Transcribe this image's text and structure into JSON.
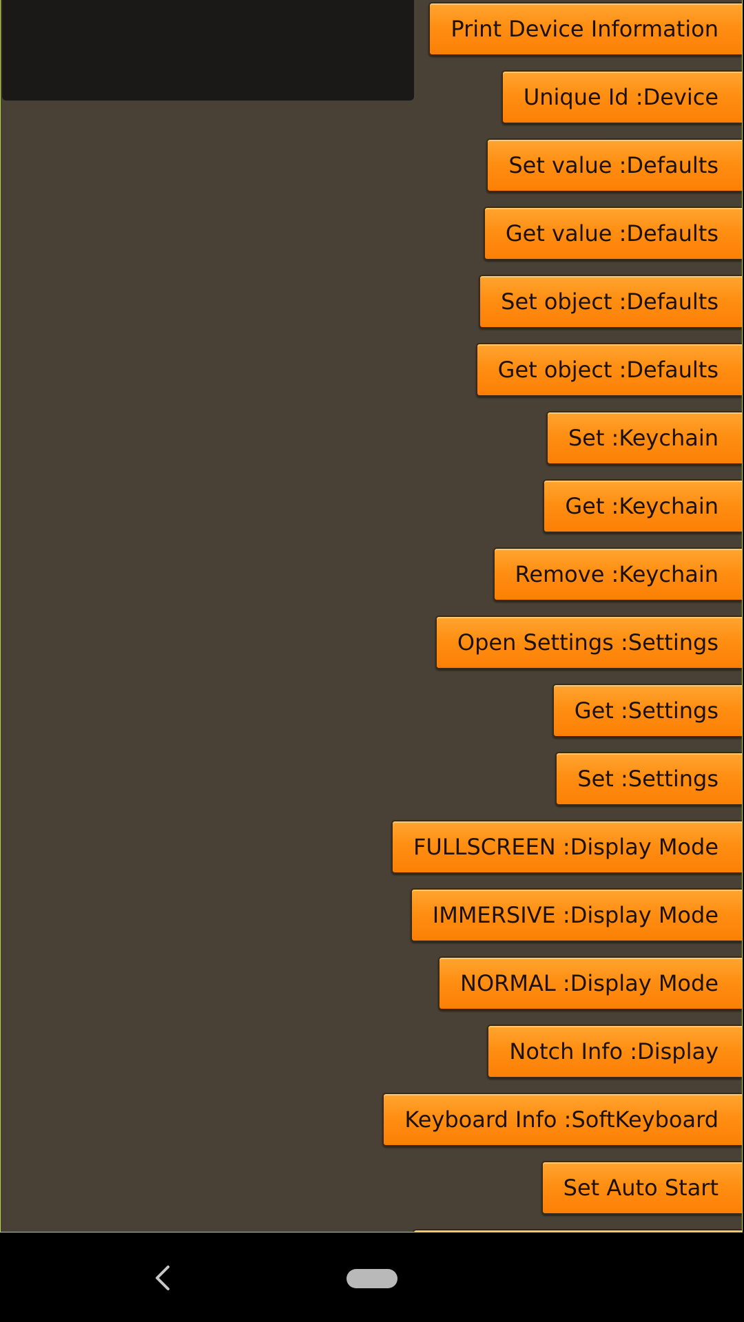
{
  "buttons": [
    {
      "id": "print-device-information",
      "label": "Print Device Information"
    },
    {
      "id": "unique-id-device",
      "label": "Unique Id :Device"
    },
    {
      "id": "set-value-defaults",
      "label": "Set value :Defaults"
    },
    {
      "id": "get-value-defaults",
      "label": "Get value :Defaults"
    },
    {
      "id": "set-object-defaults",
      "label": "Set object :Defaults"
    },
    {
      "id": "get-object-defaults",
      "label": "Get object :Defaults"
    },
    {
      "id": "set-keychain",
      "label": "Set :Keychain"
    },
    {
      "id": "get-keychain",
      "label": "Get :Keychain"
    },
    {
      "id": "remove-keychain",
      "label": "Remove :Keychain"
    },
    {
      "id": "open-settings-settings",
      "label": "Open Settings :Settings"
    },
    {
      "id": "get-settings",
      "label": "Get :Settings"
    },
    {
      "id": "set-settings",
      "label": "Set :Settings"
    },
    {
      "id": "fullscreen-display-mode",
      "label": "FULLSCREEN :Display Mode"
    },
    {
      "id": "immersive-display-mode",
      "label": "IMMERSIVE :Display Mode"
    },
    {
      "id": "normal-display-mode",
      "label": "NORMAL :Display Mode"
    },
    {
      "id": "notch-info-display",
      "label": "Notch Info :Display"
    },
    {
      "id": "keyboard-info-softkeyboard",
      "label": "Keyboard Info :SoftKeyboard"
    },
    {
      "id": "set-auto-start",
      "label": "Set Auto Start"
    }
  ],
  "nav": {
    "back_icon": "chevron-left-icon",
    "home_icon": "home-pill-icon"
  },
  "colors": {
    "background": "#4a4136",
    "log_panel": "#1b1917",
    "button_orange": "#ff8f13",
    "button_text": "#1c1105",
    "nav_bar": "#000000"
  }
}
